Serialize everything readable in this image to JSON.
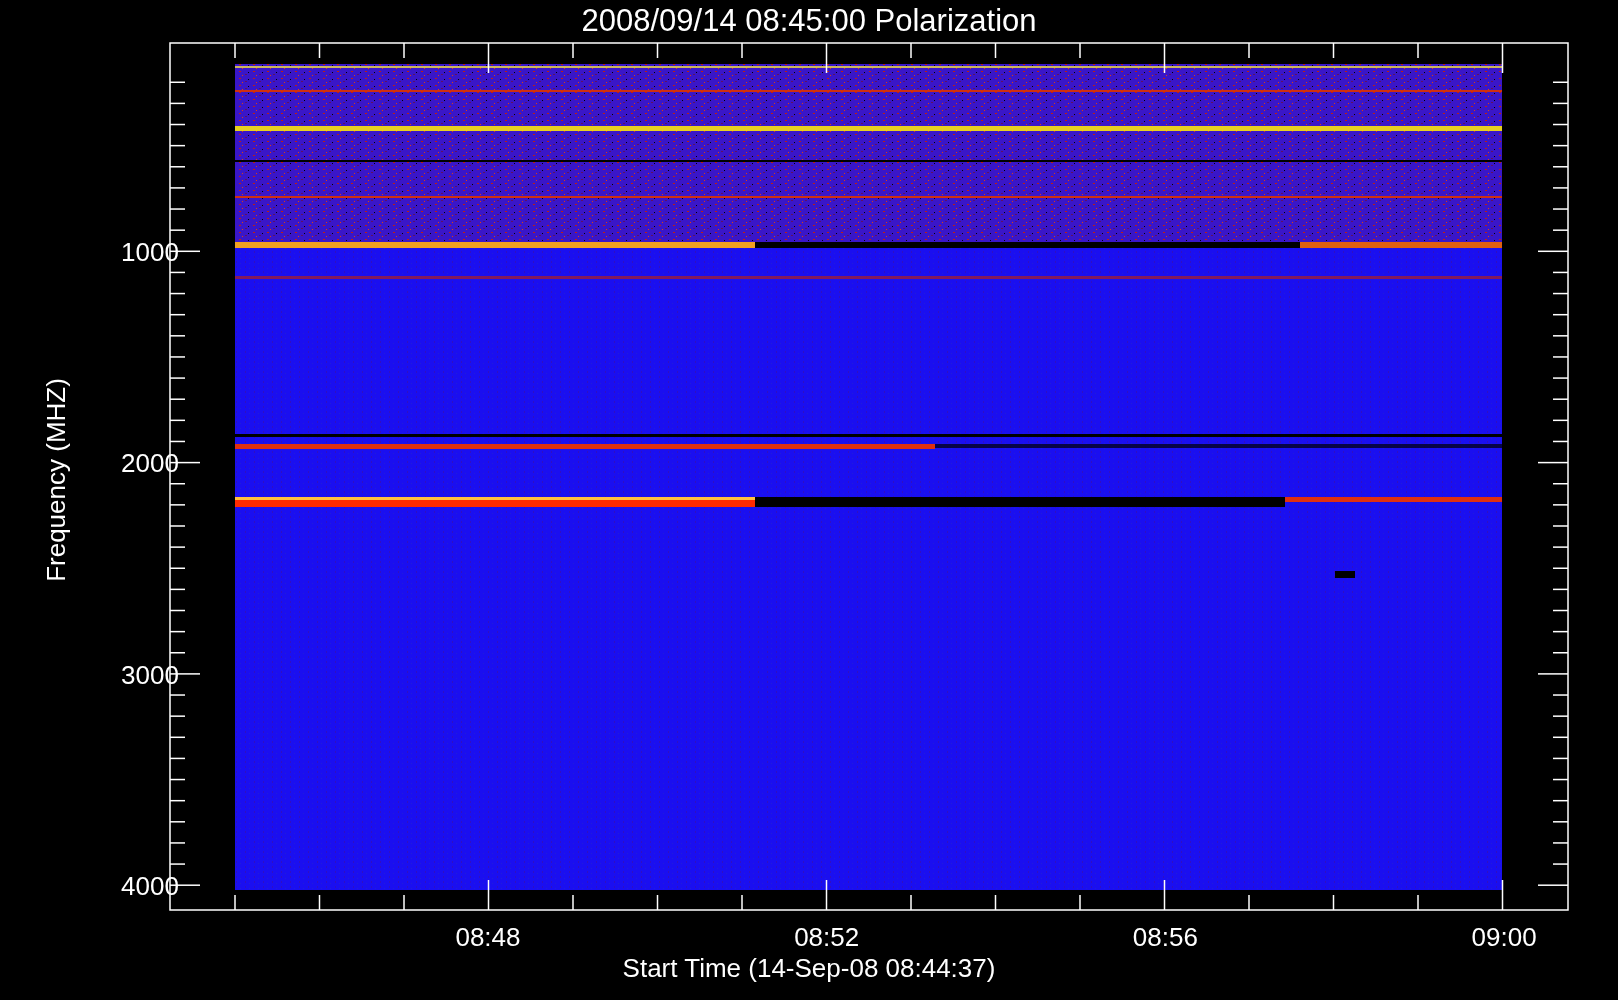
{
  "title": "2008/09/14 08:45:00 Polarization",
  "ylabel": "Frequency (MHZ)",
  "xlabel": "Start Time (14-Sep-08 08:44:37)",
  "yticks": [
    "1000",
    "2000",
    "3000",
    "4000"
  ],
  "xticks": [
    "08:48",
    "08:52",
    "08:56",
    "09:00"
  ]
}
